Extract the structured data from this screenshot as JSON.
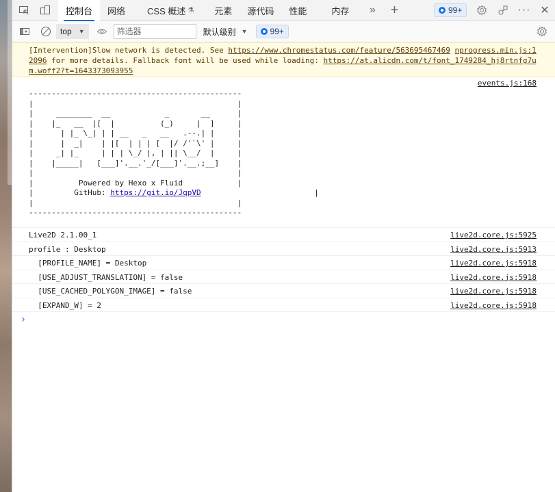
{
  "tabs": [
    {
      "label": "控制台",
      "active": true
    },
    {
      "label": "网络"
    },
    {
      "label": "CSS 概述"
    },
    {
      "label": "元素"
    },
    {
      "label": "源代码"
    },
    {
      "label": "性能"
    },
    {
      "label": "内存"
    }
  ],
  "issues_badge": "99+",
  "toolbar": {
    "context": "top",
    "filter_placeholder": "筛选器",
    "level": "默认级别",
    "issues_badge": "99+"
  },
  "console": {
    "warning": {
      "text1": "[Intervention]Slow network is detected. See ",
      "link1": "https://www.chromestatus.com/feature/563695467469",
      "text2": " ",
      "src": "nprogress.min.js:12096",
      "text3": " for more details. Fallback font will be used while loading: ",
      "link2": "https://at.alicdn.com/t/font_1749284_hj8rtnfg7um.woff2?t=1643373093955"
    },
    "banner_source": "events.js:168",
    "banner_art": "-----------------------------------------------\n|                                             |\n|     ________  __            _       __      |\n|    |_   __  |[  |          (_)     |  ]     |\n|      | |_ \\_| | | __   _   __   .--.| |     |\n|      |  _|    | |[  | | | [  |/ /'`\\' |     |\n|     _| |_     | | | \\_/ |, | || \\__/  |     |\n|    |_____|   [___]'.__.'_/[___]'.__.;__]    |\n|                                             |\n|          Powered by Hexo x Fluid            |",
    "banner_github_label": "|         GitHub: ",
    "banner_github_link": "https://git.io/JqpVD",
    "banner_art_bottom": "|                                             |\n-----------------------------------------------",
    "rows": [
      {
        "text": "Live2D 2.1.00_1",
        "src": "live2d.core.js:5925"
      },
      {
        "text": "profile : Desktop",
        "src": "live2d.core.js:5913"
      },
      {
        "text": "  [PROFILE_NAME] = Desktop",
        "src": "live2d.core.js:5918"
      },
      {
        "text": "  [USE_ADJUST_TRANSLATION] = false",
        "src": "live2d.core.js:5918"
      },
      {
        "text": "  [USE_CACHED_POLYGON_IMAGE] = false",
        "src": "live2d.core.js:5918"
      },
      {
        "text": "  [EXPAND_W] = 2",
        "src": "live2d.core.js:5918"
      }
    ],
    "prompt": "›"
  },
  "colors": {
    "accent": "#0f6cbd",
    "warning_bg": "#fffbe5",
    "link_blue": "#1a73e8"
  }
}
